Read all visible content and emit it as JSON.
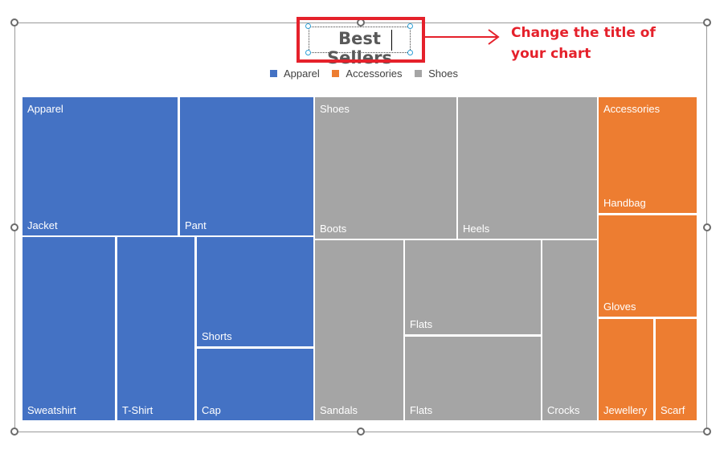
{
  "chart_data": {
    "type": "treemap",
    "title": "Best Sellers",
    "legend": {
      "placement": "top",
      "entries": [
        {
          "name": "Apparel",
          "color": "#4472C4"
        },
        {
          "name": "Accessories",
          "color": "#ED7D31"
        },
        {
          "name": "Shoes",
          "color": "#A5A5A5"
        }
      ]
    },
    "categories": [
      {
        "name": "Apparel",
        "color": "#4472C4",
        "items": [
          {
            "name": "Jacket",
            "value": 30
          },
          {
            "name": "Pant",
            "value": 26
          },
          {
            "name": "Sweatshirt",
            "value": 20
          },
          {
            "name": "T-Shirt",
            "value": 16
          },
          {
            "name": "Shorts",
            "value": 12
          },
          {
            "name": "Cap",
            "value": 10
          }
        ]
      },
      {
        "name": "Shoes",
        "color": "#A5A5A5",
        "items": [
          {
            "name": "Boots",
            "value": 28
          },
          {
            "name": "Heels",
            "value": 28
          },
          {
            "name": "Sandals",
            "value": 18
          },
          {
            "name": "Flats",
            "value": 14
          },
          {
            "name": "Flats",
            "value": 12
          },
          {
            "name": "Crocks",
            "value": 11
          }
        ]
      },
      {
        "name": "Accessories",
        "color": "#ED7D31",
        "items": [
          {
            "name": "Handbag",
            "value": 12
          },
          {
            "name": "Gloves",
            "value": 12
          },
          {
            "name": "Jewellery",
            "value": 8
          },
          {
            "name": "Scarf",
            "value": 6
          }
        ]
      }
    ]
  },
  "annotation": {
    "callout_line1": "Change the title of",
    "callout_line2": "your chart",
    "highlight_color": "#E5212B",
    "arrow": "right-arrow"
  }
}
